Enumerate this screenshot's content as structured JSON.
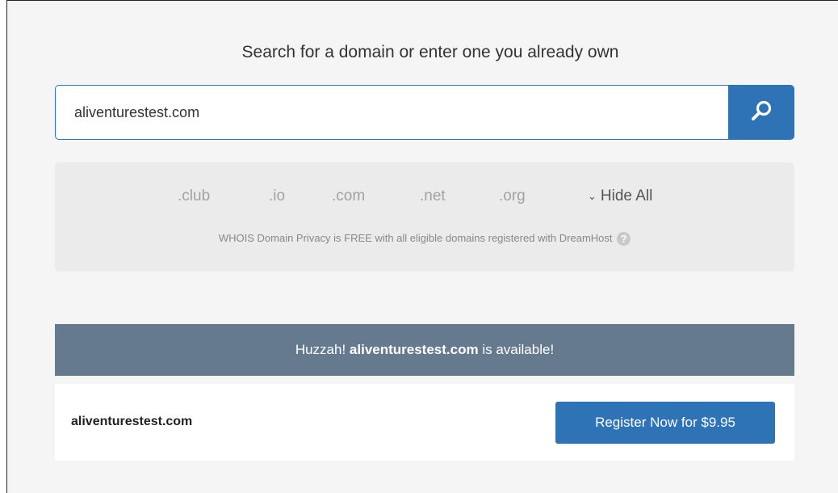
{
  "search": {
    "heading": "Search for a domain or enter one you already own",
    "value": "aliventurestest.com"
  },
  "tlds": {
    "items": [
      ".club",
      ".io",
      ".com",
      ".net",
      ".org"
    ],
    "hide_all_label": "Hide All",
    "whois_note": "WHOIS Domain Privacy is FREE with all eligible domains registered with DreamHost",
    "help_icon": "?"
  },
  "result": {
    "banner_prefix": "Huzzah!",
    "banner_domain": "aliventurestest.com",
    "banner_suffix": "is available!",
    "domain": "aliventurestest.com",
    "register_label": "Register Now for $9.95"
  },
  "colors": {
    "accent": "#2f73b7",
    "banner": "#667a8f",
    "panel": "#ebebeb"
  }
}
